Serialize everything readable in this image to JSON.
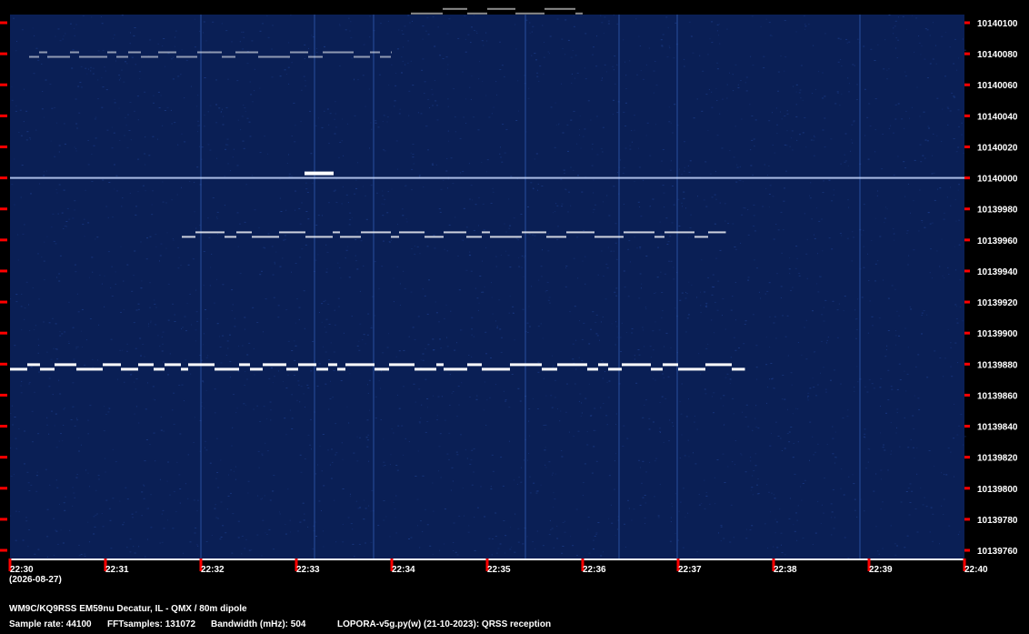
{
  "chart_data": {
    "type": "heatmap",
    "title": "",
    "xlabel": "",
    "ylabel": "",
    "x_tick_labels": [
      "22:30",
      "22:31",
      "22:32",
      "22:33",
      "22:34",
      "22:35",
      "22:36",
      "22:37",
      "22:38",
      "22:39",
      "22:40"
    ],
    "y_tick_labels": [
      "10140100",
      "10140080",
      "10140060",
      "10140040",
      "10140020",
      "10140000",
      "10139980",
      "10139960",
      "10139940",
      "10139920",
      "10139900",
      "10139880",
      "10139860",
      "10139840",
      "10139820",
      "10139800",
      "10139780",
      "10139760"
    ],
    "ylim_hz": [
      10139755,
      10140110
    ],
    "colors": {
      "background": "#0a1f55",
      "noise": "#1c3d8a",
      "signal": "#ffffff",
      "tick": "#ff0000"
    },
    "signals": [
      {
        "freq_hz": 10140000,
        "start": "22:30",
        "end": "22:40",
        "strength": "steady carrier"
      },
      {
        "freq_hz": 10139877,
        "start": "22:30",
        "end": "22:37.7",
        "strength": "strong keyed"
      },
      {
        "freq_hz": 10139962,
        "start": "22:31.8",
        "end": "22:37.5",
        "strength": "medium keyed"
      },
      {
        "freq_hz": 10140078,
        "start": "22:30.2",
        "end": "22:34",
        "strength": "weak keyed"
      },
      {
        "freq_hz": 10140106,
        "start": "22:34.2",
        "end": "22:36",
        "strength": "weak"
      }
    ]
  },
  "date_label": "(2026-08-27)",
  "footer": {
    "station": "WM9C/KQ9RSS EM59nu Decatur, IL - QMX / 80m dipole",
    "sample_rate": "Sample rate: 44100",
    "fft": "FFTsamples: 131072",
    "bandwidth": "Bandwidth (mHz): 504",
    "software": "LOPORA-v5g.py(w) (21-10-2023): QRSS reception"
  }
}
